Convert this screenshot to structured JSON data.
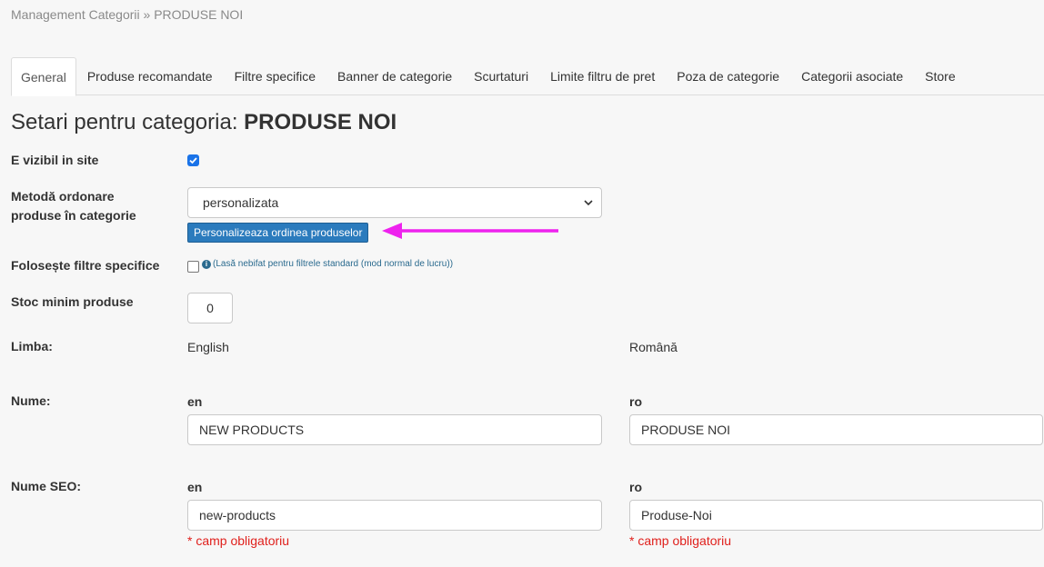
{
  "breadcrumb": "Management Categorii » PRODUSE NOI",
  "tabs": [
    {
      "label": "General",
      "active": true
    },
    {
      "label": "Produse recomandate"
    },
    {
      "label": "Filtre specifice"
    },
    {
      "label": "Banner de categorie"
    },
    {
      "label": "Scurtaturi"
    },
    {
      "label": "Limite filtru de pret"
    },
    {
      "label": "Poza de categorie"
    },
    {
      "label": "Categorii asociate"
    },
    {
      "label": "Store"
    }
  ],
  "title": {
    "prefix": "Setari pentru categoria: ",
    "name": "PRODUSE NOI"
  },
  "visible": {
    "label": "E vizibil in site",
    "checked": true
  },
  "order": {
    "label_line1": "Metodă ordonare",
    "label_line2": "produse în categorie",
    "selected": "personalizata",
    "button_label": "Personalizeaza ordinea produselor",
    "arrow_color": "#ee22ee"
  },
  "filters": {
    "label": "Folosește filtre specifice",
    "checked": false,
    "hint": "(Lasă nebifat pentru filtrele standard (mod normal de lucru))",
    "hint_icon": "i"
  },
  "stock": {
    "label": "Stoc minim produse",
    "value": "0"
  },
  "language": {
    "label": "Limba:",
    "col1": "English",
    "col2": "Română"
  },
  "name": {
    "label": "Nume:",
    "en_code": "en",
    "en_value": "NEW PRODUCTS",
    "ro_code": "ro",
    "ro_value": "PRODUSE NOI"
  },
  "seo": {
    "label": "Nume SEO:",
    "en_code": "en",
    "en_value": "new-products",
    "ro_code": "ro",
    "ro_value": "Produse-Noi",
    "required": "* camp obligatoriu"
  },
  "colors": {
    "accent": "#2b7bbd",
    "required": "#e0201c",
    "checkbox": "#1a73e8"
  }
}
